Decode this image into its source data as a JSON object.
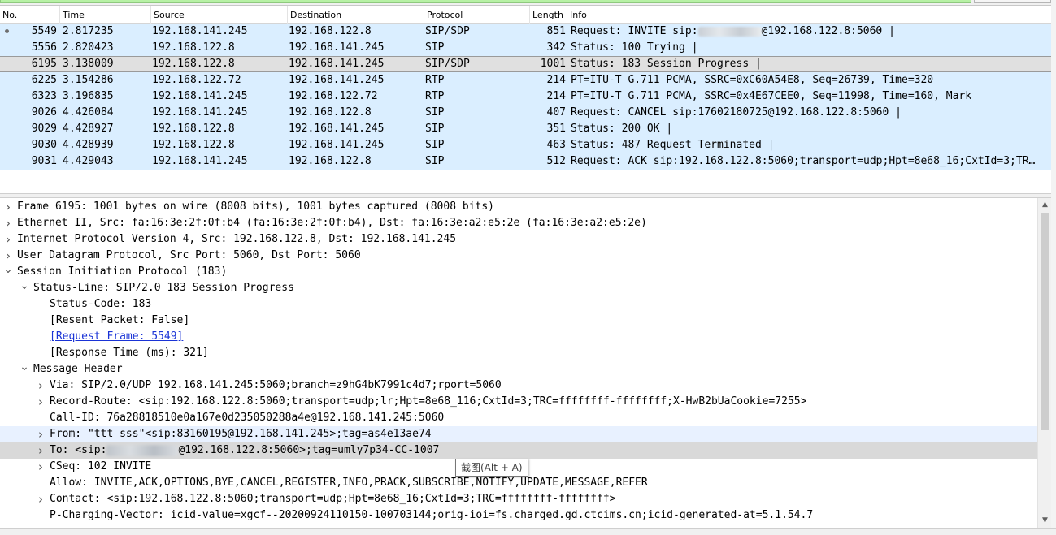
{
  "columns": {
    "no": "No.",
    "time": "Time",
    "source": "Source",
    "destination": "Destination",
    "protocol": "Protocol",
    "length": "Length",
    "info": "Info"
  },
  "packets": [
    {
      "no": "5549",
      "time": "2.817235",
      "source": "192.168.141.245",
      "destination": "192.168.122.8",
      "protocol": "SIP/SDP",
      "length": "851",
      "info_pre": "Request: INVITE sip:",
      "info_post": "@192.168.122.8:5060 |",
      "redacted": true,
      "selected": false
    },
    {
      "no": "5556",
      "time": "2.820423",
      "source": "192.168.122.8",
      "destination": "192.168.141.245",
      "protocol": "SIP",
      "length": "342",
      "info_pre": "Status: 100 Trying |",
      "info_post": "",
      "redacted": false,
      "selected": false
    },
    {
      "no": "6195",
      "time": "3.138009",
      "source": "192.168.122.8",
      "destination": "192.168.141.245",
      "protocol": "SIP/SDP",
      "length": "1001",
      "info_pre": "Status: 183 Session Progress |",
      "info_post": "",
      "redacted": false,
      "selected": true
    },
    {
      "no": "6225",
      "time": "3.154286",
      "source": "192.168.122.72",
      "destination": "192.168.141.245",
      "protocol": "RTP",
      "length": "214",
      "info_pre": "PT=ITU-T G.711 PCMA, SSRC=0xC60A54E8, Seq=26739, Time=320",
      "info_post": "",
      "redacted": false,
      "selected": false
    },
    {
      "no": "6323",
      "time": "3.196835",
      "source": "192.168.141.245",
      "destination": "192.168.122.72",
      "protocol": "RTP",
      "length": "214",
      "info_pre": "PT=ITU-T G.711 PCMA, SSRC=0x4E67CEE0, Seq=11998, Time=160, Mark",
      "info_post": "",
      "redacted": false,
      "selected": false
    },
    {
      "no": "9026",
      "time": "4.426084",
      "source": "192.168.141.245",
      "destination": "192.168.122.8",
      "protocol": "SIP",
      "length": "407",
      "info_pre": "Request: CANCEL sip:17602180725@192.168.122.8:5060 |",
      "info_post": "",
      "redacted": false,
      "selected": false
    },
    {
      "no": "9029",
      "time": "4.428927",
      "source": "192.168.122.8",
      "destination": "192.168.141.245",
      "protocol": "SIP",
      "length": "351",
      "info_pre": "Status: 200 OK |",
      "info_post": "",
      "redacted": false,
      "selected": false
    },
    {
      "no": "9030",
      "time": "4.428939",
      "source": "192.168.122.8",
      "destination": "192.168.141.245",
      "protocol": "SIP",
      "length": "463",
      "info_pre": "Status: 487 Request Terminated |",
      "info_post": "",
      "redacted": false,
      "selected": false
    },
    {
      "no": "9031",
      "time": "4.429043",
      "source": "192.168.141.245",
      "destination": "192.168.122.8",
      "protocol": "SIP",
      "length": "512",
      "info_pre": "Request: ACK sip:192.168.122.8:5060;transport=udp;Hpt=8e68_16;CxtId=3;TR…",
      "info_post": "",
      "redacted": false,
      "selected": false
    }
  ],
  "details": [
    {
      "level": 0,
      "arrow": "collapsed",
      "text": "Frame 6195: 1001 bytes on wire (8008 bits), 1001 bytes captured (8008 bits)"
    },
    {
      "level": 0,
      "arrow": "collapsed",
      "text": "Ethernet II, Src: fa:16:3e:2f:0f:b4 (fa:16:3e:2f:0f:b4), Dst: fa:16:3e:a2:e5:2e (fa:16:3e:a2:e5:2e)"
    },
    {
      "level": 0,
      "arrow": "collapsed",
      "text": "Internet Protocol Version 4, Src: 192.168.122.8, Dst: 192.168.141.245"
    },
    {
      "level": 0,
      "arrow": "collapsed",
      "text": "User Datagram Protocol, Src Port: 5060, Dst Port: 5060"
    },
    {
      "level": 0,
      "arrow": "expanded",
      "text": "Session Initiation Protocol (183)"
    },
    {
      "level": 1,
      "arrow": "expanded",
      "text": "Status-Line: SIP/2.0 183 Session Progress"
    },
    {
      "level": 2,
      "arrow": "none",
      "text": "Status-Code: 183"
    },
    {
      "level": 2,
      "arrow": "none",
      "text": "[Resent Packet: False]"
    },
    {
      "level": 2,
      "arrow": "none",
      "text": "[Request Frame: 5549]",
      "link": true
    },
    {
      "level": 2,
      "arrow": "none",
      "text": "[Response Time (ms): 321]"
    },
    {
      "level": 1,
      "arrow": "expanded",
      "text": "Message Header"
    },
    {
      "level": 2,
      "arrow": "collapsed",
      "text": "Via: SIP/2.0/UDP 192.168.141.245:5060;branch=z9hG4bK7991c4d7;rport=5060"
    },
    {
      "level": 2,
      "arrow": "collapsed",
      "text": "Record-Route: <sip:192.168.122.8:5060;transport=udp;lr;Hpt=8e68_116;CxtId=3;TRC=ffffffff-ffffffff;X-HwB2bUaCookie=7255>"
    },
    {
      "level": 2,
      "arrow": "none",
      "text": "Call-ID: 76a28818510e0a167e0d235050288a4e@192.168.141.245:5060"
    },
    {
      "level": 2,
      "arrow": "collapsed",
      "text": "From: \"ttt sss\"<sip:83160195@192.168.141.245>;tag=as4e13ae74",
      "highlight": "blue"
    },
    {
      "level": 2,
      "arrow": "collapsed",
      "text_pre": "To: <sip:",
      "text_post": "@192.168.122.8:5060>;tag=umly7p34-CC-1007",
      "redacted": true,
      "highlight": "gray"
    },
    {
      "level": 2,
      "arrow": "collapsed",
      "text": "CSeq: 102 INVITE"
    },
    {
      "level": 2,
      "arrow": "none",
      "text": "Allow: INVITE,ACK,OPTIONS,BYE,CANCEL,REGISTER,INFO,PRACK,SUBSCRIBE,NOTIFY,UPDATE,MESSAGE,REFER"
    },
    {
      "level": 2,
      "arrow": "collapsed",
      "text": "Contact: <sip:192.168.122.8:5060;transport=udp;Hpt=8e68_16;CxtId=3;TRC=ffffffff-ffffffff>"
    },
    {
      "level": 2,
      "arrow": "none",
      "text": "P-Charging-Vector: icid-value=xgcf--20200924110150-100703144;orig-ioi=fs.charged.gd.ctcims.cn;icid-generated-at=5.1.54.7"
    }
  ],
  "tooltip": "截图(Alt + A)",
  "colors": {
    "row_bg": "#daeeff",
    "selected_bg": "#e0e0e0",
    "link": "#1a33d6",
    "filter_bar": "#b7f1a5"
  },
  "icons": {
    "collapsed": "chevron-right-icon",
    "expanded": "chevron-down-icon",
    "scroll_up": "scroll-up-icon",
    "scroll_down": "scroll-down-icon"
  }
}
